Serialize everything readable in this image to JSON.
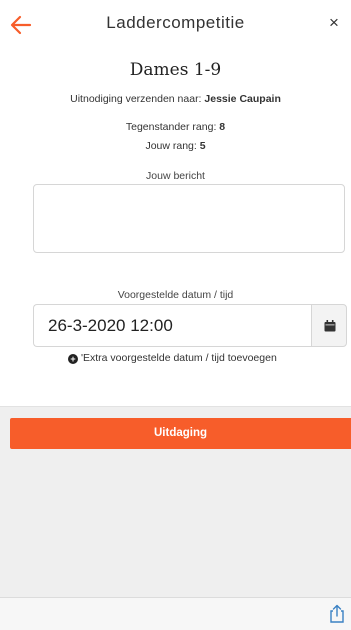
{
  "header": {
    "title": "Laddercompetitie",
    "back_icon": "arrow-left-icon",
    "close_label": "×",
    "accent_color": "#f75d2a"
  },
  "challenge": {
    "heading": "Dames 1-9",
    "invite_prefix": "Uitnodiging verzenden naar: ",
    "invitee": "Jessie Caupain",
    "opponent_rank_label": "Tegenstander rang: ",
    "opponent_rank": "8",
    "own_rank_label": "Jouw rang: ",
    "own_rank": "5"
  },
  "message": {
    "label": "Jouw bericht",
    "value": ""
  },
  "date": {
    "label": "Voorgestelde datum / tijd",
    "value": "26-3-2020 12:00",
    "calendar_icon": "calendar-icon",
    "add_extra_label": "'Extra voorgestelde datum / tijd toevoegen"
  },
  "actions": {
    "submit_label": "Uitdaging",
    "submit_color": "#f75d2a",
    "share_icon": "share-icon"
  }
}
